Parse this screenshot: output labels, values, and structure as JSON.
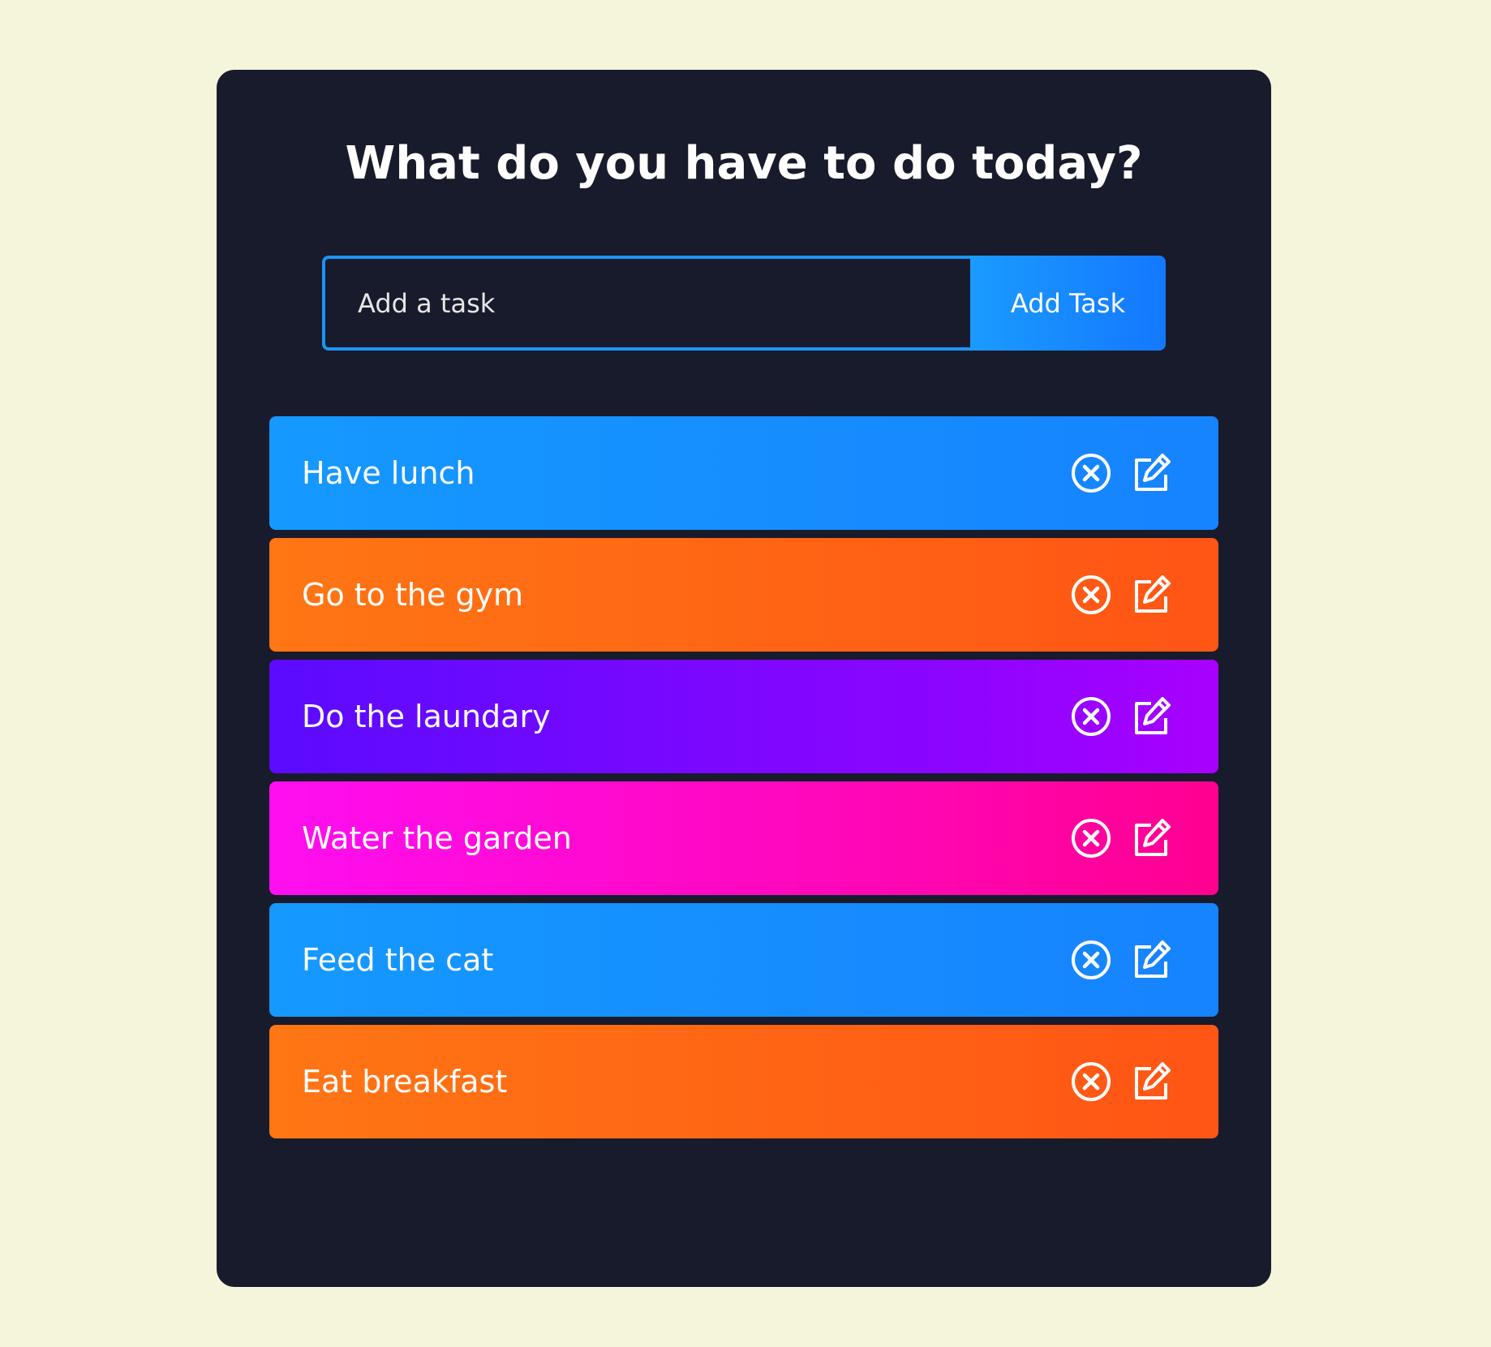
{
  "header": {
    "title": "What do you have to do today?"
  },
  "form": {
    "placeholder": "Add a task",
    "value": "",
    "button_label": "Add Task"
  },
  "todos": [
    {
      "text": "Have lunch",
      "color": "blue"
    },
    {
      "text": "Go to the gym",
      "color": "orange"
    },
    {
      "text": "Do the laundary",
      "color": "purple"
    },
    {
      "text": "Water the garden",
      "color": "pink"
    },
    {
      "text": "Feed the cat",
      "color": "blue"
    },
    {
      "text": "Eat breakfast",
      "color": "orange"
    }
  ],
  "icons": {
    "delete": "close-circle-icon",
    "edit": "edit-icon"
  },
  "colors": {
    "page_background": "#f5f5dc",
    "panel_background": "#181b2b",
    "accent": "#1b94f5",
    "blue_start": "#1599ff",
    "blue_end": "#1683ff",
    "orange_start": "#ff7614",
    "orange_end": "#ff5515",
    "purple_start": "#5b0bff",
    "purple_end": "#a800ff",
    "pink_start": "#ff0ef1",
    "pink_end": "#ff0090"
  }
}
